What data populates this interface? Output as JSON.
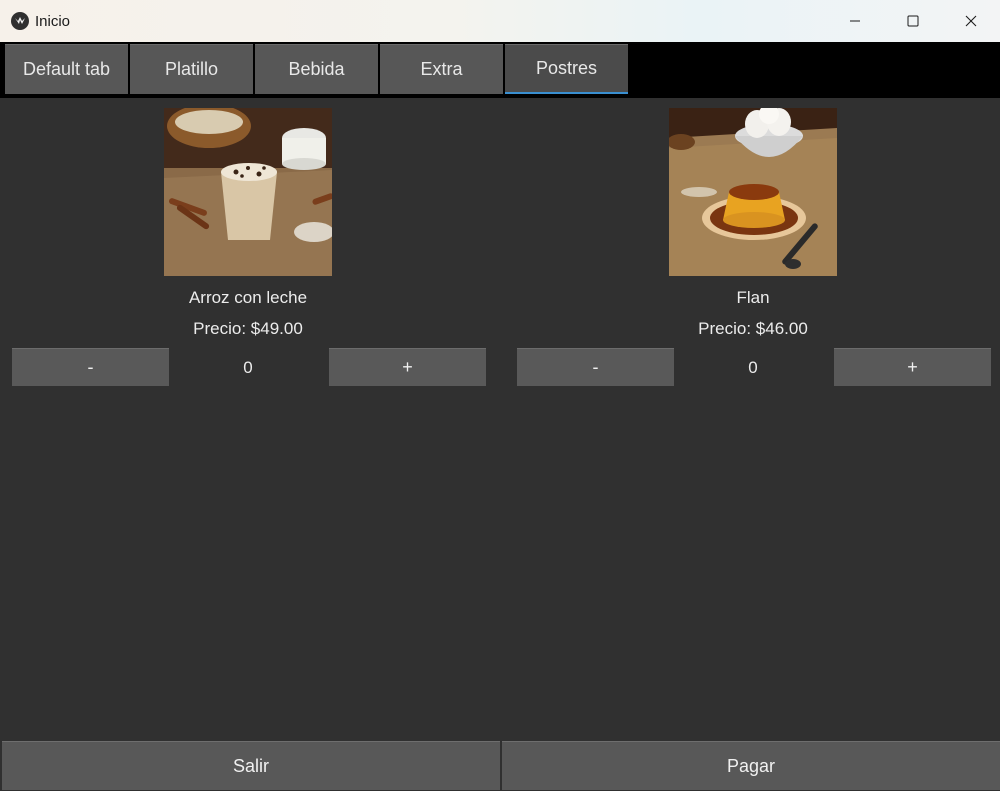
{
  "window": {
    "title": "Inicio",
    "app_icon": "kivy-logo-icon",
    "controls": [
      "minimize-icon",
      "maximize-icon",
      "close-icon"
    ]
  },
  "tabs": [
    {
      "label": "Default tab",
      "active": false
    },
    {
      "label": "Platillo",
      "active": false
    },
    {
      "label": "Bebida",
      "active": false
    },
    {
      "label": "Extra",
      "active": false
    },
    {
      "label": "Postres",
      "active": true
    }
  ],
  "products": [
    {
      "name": "Arroz con leche",
      "price": "Precio: $49.00",
      "quantity": "0",
      "minus_label": "-",
      "plus_label": "+"
    },
    {
      "name": "Flan",
      "price": "Precio: $46.00",
      "quantity": "0",
      "minus_label": "-",
      "plus_label": "+"
    }
  ],
  "footer": {
    "exit_label": "Salir",
    "pay_label": "Pagar"
  },
  "colors": {
    "background": "#303030",
    "button": "#585858",
    "tab_active_indicator": "#3a8fd0",
    "tabstrip": "#000000"
  }
}
